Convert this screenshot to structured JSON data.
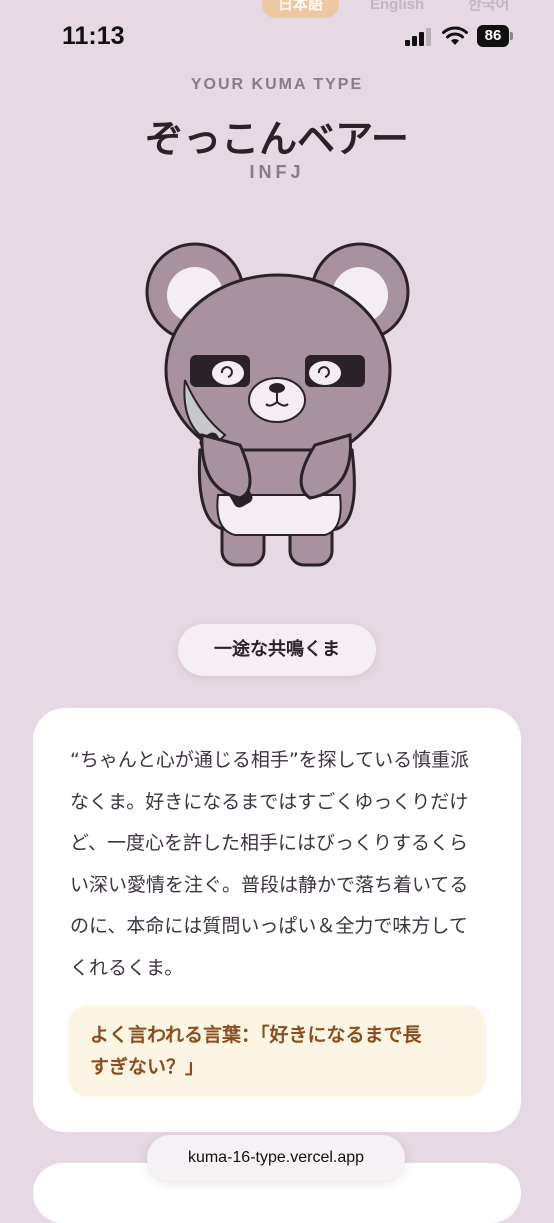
{
  "status_bar": {
    "time": "11:13",
    "battery": "86"
  },
  "language_tabs": [
    {
      "label": "日本語",
      "active": true
    },
    {
      "label": "English",
      "active": false
    },
    {
      "label": "한국어",
      "active": false
    }
  ],
  "result": {
    "eyebrow": "YOUR KUMA TYPE",
    "type_name": "ぞっこんベアー",
    "mbti": "INFJ",
    "tagline": "一途な共鳴くま"
  },
  "description": {
    "lines": [
      "“ちゃんと心が通じる相手”を探している慎重派",
      "なくま。好きになるまではすごくゆっくりだけ",
      "ど、一度心を許した相手にはびっくりするくら",
      "い深い愛情を注ぐ。普段は静かで落ち着いてる",
      "のに、本命には質問いっぱい＆全力で味方して",
      "くれるくま。"
    ],
    "quote_lines": [
      "よく言われる言葉：「好きになるまで長",
      "すぎない？」"
    ]
  },
  "browser": {
    "url": "kuma-16-type.vercel.app"
  },
  "colors": {
    "background": "#e6d9e3",
    "accent_tab": "#efc494",
    "bear_fur": "#a8929f",
    "quote_bg": "#fdf5e3",
    "quote_text": "#8a4d1e"
  },
  "icons": [
    "signal-icon",
    "wifi-icon",
    "battery-icon",
    "bear-illustration"
  ]
}
